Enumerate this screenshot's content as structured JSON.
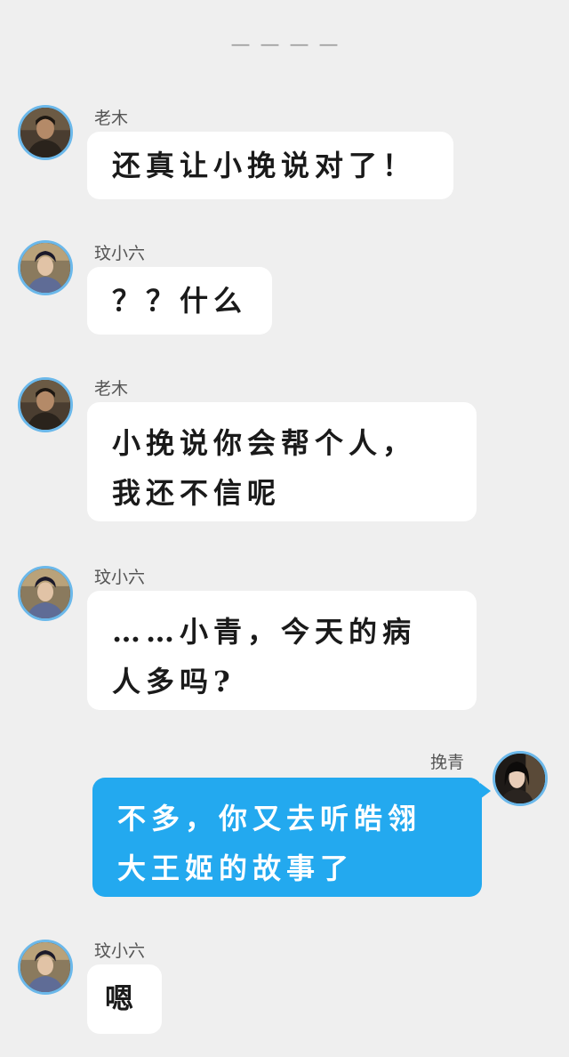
{
  "chat": {
    "top_separator": "— — — —",
    "messages": [
      {
        "sender": "老木",
        "text": "还真让小挽说对了！",
        "side": "left",
        "avatar_icon": "man-portrait-icon"
      },
      {
        "sender": "玟小六",
        "text": "？？什么",
        "side": "left",
        "avatar_icon": "woman-portrait-icon"
      },
      {
        "sender": "老木",
        "text": "小挽说你会帮个人，\n我还不信呢",
        "side": "left",
        "avatar_icon": "man-portrait-icon"
      },
      {
        "sender": "玟小六",
        "text": "……小青，今天的病\n人多吗?",
        "side": "left",
        "avatar_icon": "woman-portrait-icon"
      },
      {
        "sender": "挽青",
        "text": "不多，你又去听皓翎\n大王姬的故事了",
        "side": "right",
        "avatar_icon": "girl-portrait-icon"
      },
      {
        "sender": "玟小六",
        "text": "嗯",
        "side": "left",
        "avatar_icon": "woman-portrait-icon"
      }
    ]
  },
  "colors": {
    "background": "#efefef",
    "bubble_left": "#ffffff",
    "bubble_right": "#23a9ef",
    "avatar_ring": "#6bb8ea"
  }
}
